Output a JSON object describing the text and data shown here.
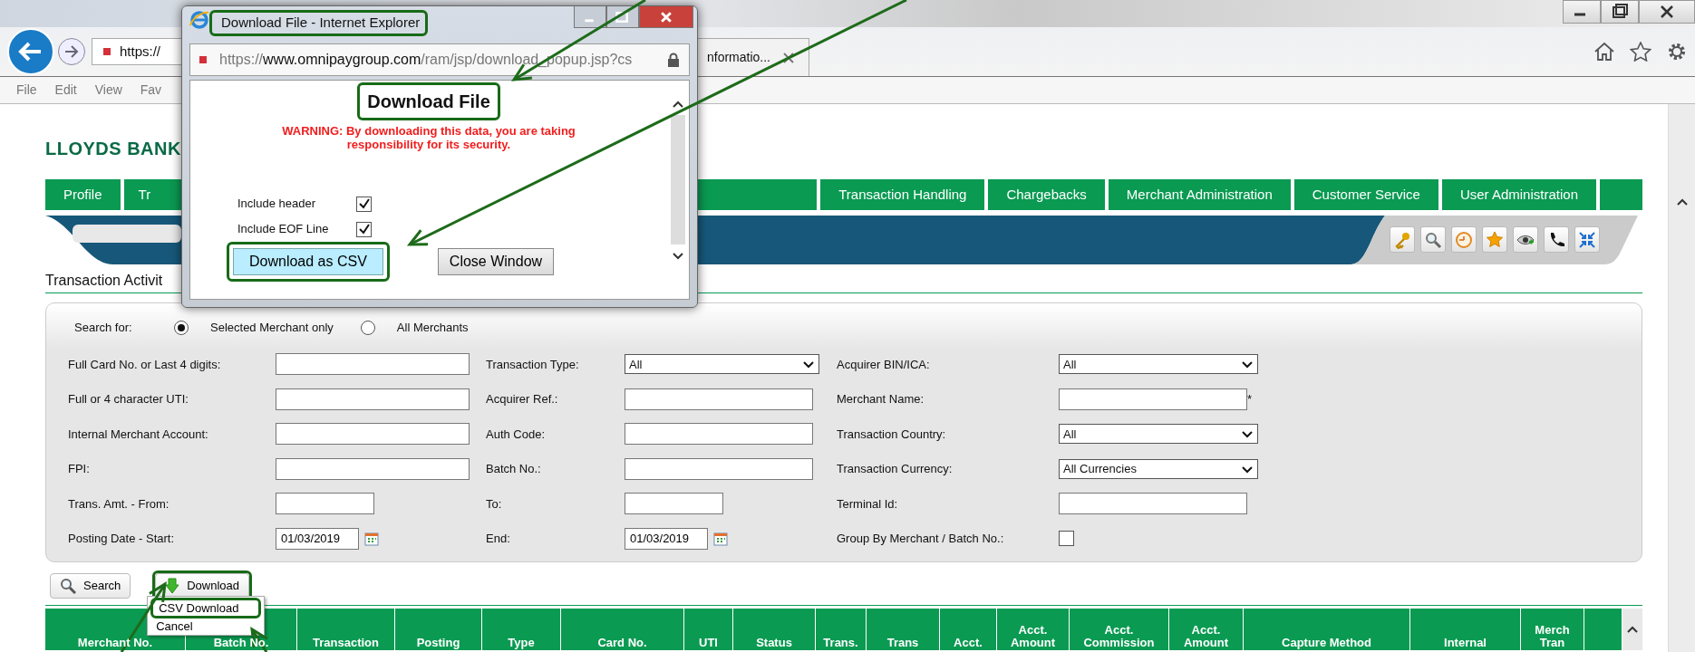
{
  "browser": {
    "address": "https://",
    "tab_title": "nformatio...",
    "menu": [
      "File",
      "Edit",
      "View",
      "Fav"
    ]
  },
  "page": {
    "logo": "LLOYDS BANK",
    "nav": [
      {
        "label": "Profile",
        "covered": false
      },
      {
        "label": "Tr",
        "covered": true
      },
      {
        "label": "Transaction Handling",
        "covered": false
      },
      {
        "label": "Chargebacks",
        "covered": false
      },
      {
        "label": "Merchant Administration",
        "covered": false
      },
      {
        "label": "Customer Service",
        "covered": false
      },
      {
        "label": "User Administration",
        "covered": false
      }
    ],
    "section_title": "Transaction Activit",
    "search_for": {
      "label": "Search for:",
      "options": [
        {
          "label": "Selected Merchant only",
          "selected": true
        },
        {
          "label": "All Merchants",
          "selected": false
        }
      ]
    },
    "form_rows": [
      [
        {
          "label": "Full Card No. or Last 4 digits:",
          "kind": "text"
        },
        {
          "label": "Transaction Type:",
          "kind": "select",
          "value": "All"
        },
        {
          "label": "Acquirer BIN/ICA:",
          "kind": "select",
          "value": "All"
        }
      ],
      [
        {
          "label": "Full or 4 character UTI:",
          "kind": "text"
        },
        {
          "label": "Acquirer Ref.:",
          "kind": "text"
        },
        {
          "label": "Merchant Name:",
          "kind": "text",
          "suffix": "*"
        }
      ],
      [
        {
          "label": "Internal Merchant Account:",
          "kind": "text"
        },
        {
          "label": "Auth Code:",
          "kind": "text"
        },
        {
          "label": "Transaction Country:",
          "kind": "select",
          "value": "All"
        }
      ],
      [
        {
          "label": "FPI:",
          "kind": "text"
        },
        {
          "label": "Batch No.:",
          "kind": "text"
        },
        {
          "label": "Transaction Currency:",
          "kind": "select",
          "value": "All Currencies"
        }
      ],
      [
        {
          "label": "Trans. Amt. - From:",
          "kind": "short"
        },
        {
          "label": "To:",
          "kind": "short"
        },
        {
          "label": "Terminal Id:",
          "kind": "text"
        }
      ],
      [
        {
          "label": "Posting Date - Start:",
          "kind": "date",
          "value": "01/03/2019"
        },
        {
          "label": "End:",
          "kind": "date",
          "value": "01/03/2019"
        },
        {
          "label": "Group By Merchant / Batch No.:",
          "kind": "checkbox",
          "checked": false
        }
      ]
    ],
    "buttons": [
      {
        "label": "Search",
        "kind": "search",
        "highlighted": false
      },
      {
        "label": "Download",
        "kind": "download",
        "highlighted": true
      }
    ],
    "download_menu": [
      {
        "label": "CSV Download",
        "highlighted": true
      },
      {
        "label": "Cancel",
        "highlighted": false
      }
    ],
    "table": {
      "columns": [
        {
          "lines": [
            "Merchant No."
          ]
        },
        {
          "lines": [
            "Batch No."
          ]
        },
        {
          "lines": [
            "Transaction"
          ]
        },
        {
          "lines": [
            "Posting"
          ]
        },
        {
          "lines": [
            "Type"
          ]
        },
        {
          "lines": [
            "Card No."
          ]
        },
        {
          "lines": [
            "UTI"
          ]
        },
        {
          "lines": [
            "Status"
          ]
        },
        {
          "lines": [
            "Trans."
          ]
        },
        {
          "lines": [
            "Trans"
          ]
        },
        {
          "lines": [
            "Acct."
          ]
        },
        {
          "lines": [
            "Acct.",
            "Amount"
          ]
        },
        {
          "lines": [
            "Acct.",
            "Commission"
          ]
        },
        {
          "lines": [
            "Acct.",
            "Amount"
          ]
        },
        {
          "lines": [
            "Capture Method"
          ]
        },
        {
          "lines": [
            "Internal"
          ]
        },
        {
          "lines": [
            "Merch",
            "Tran"
          ]
        }
      ]
    }
  },
  "popup": {
    "title": "Download File - Internet Explorer",
    "title_highlighted": true,
    "url": {
      "scheme": "https://",
      "host": "www.omnipaygroup.com",
      "path": "/ram/jsp/download_popup.jsp?cs"
    },
    "heading": "Download File",
    "heading_highlighted": true,
    "warning": "WARNING: By downloading this data, you are taking responsibility for its security.",
    "options": [
      {
        "label": "Include header",
        "checked": true
      },
      {
        "label": "Include EOF Line",
        "checked": true
      }
    ],
    "buttons": [
      {
        "label": "Download as CSV",
        "kind": "primary",
        "highlighted": true
      },
      {
        "label": "Close Window",
        "kind": "default",
        "highlighted": false
      }
    ]
  }
}
